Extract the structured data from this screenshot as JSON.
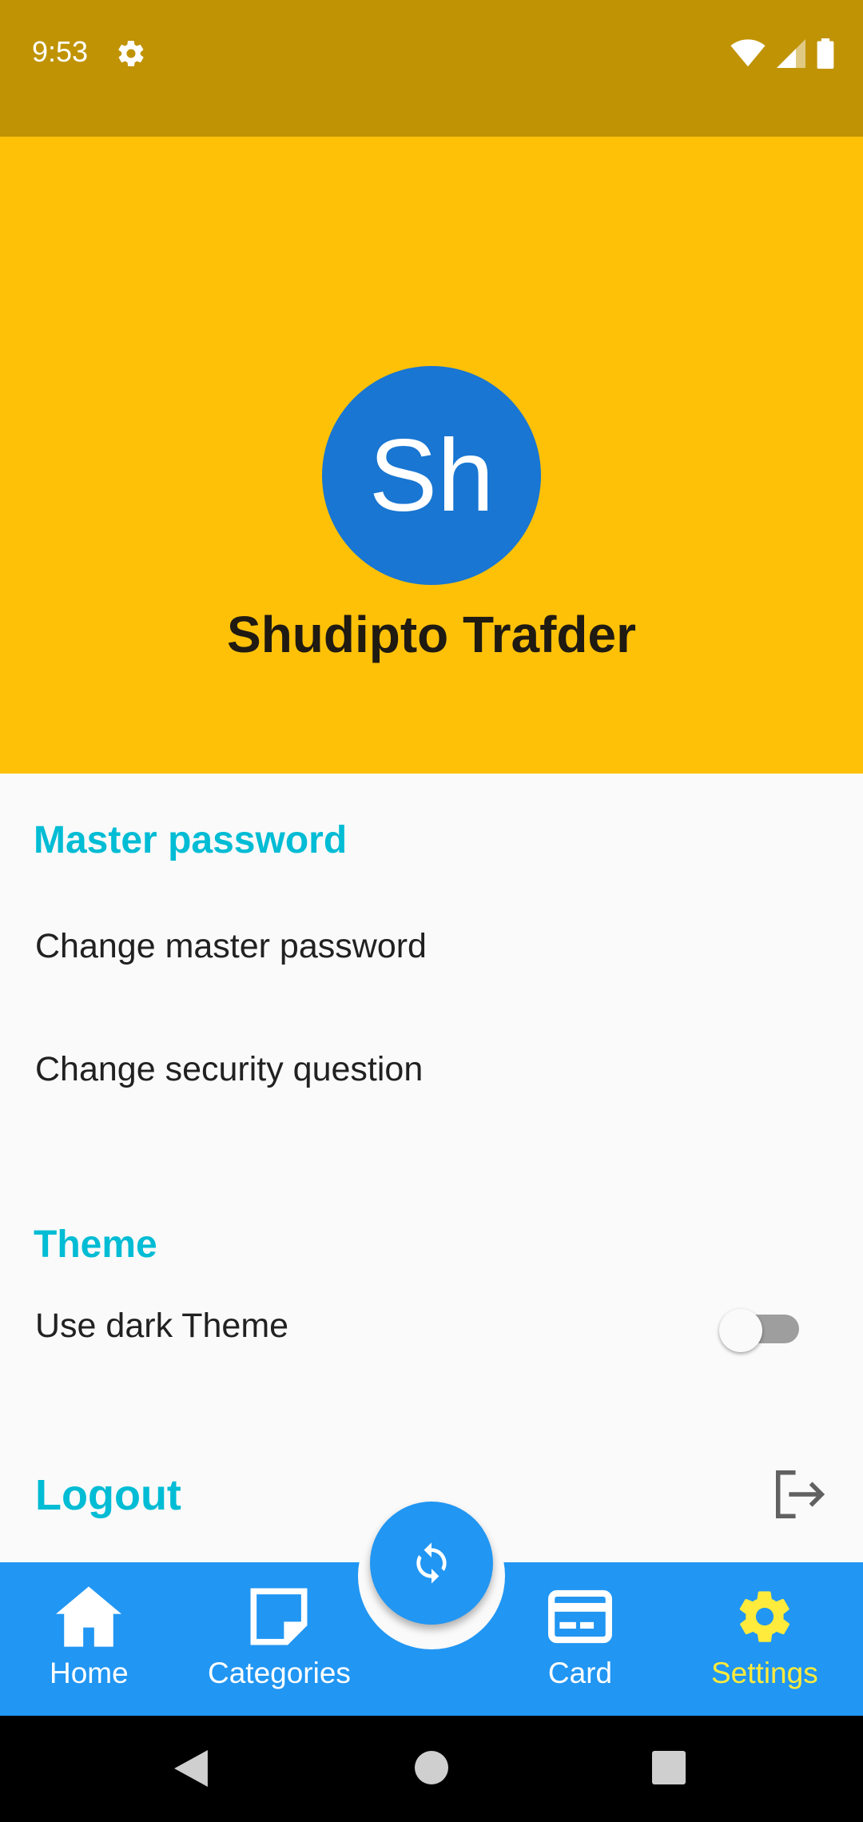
{
  "status_bar": {
    "time": "9:53"
  },
  "profile": {
    "initials": "Sh",
    "name": "Shudipto Trafder"
  },
  "sections": {
    "master_password": {
      "title": "Master password",
      "change_password": "Change master password",
      "change_question": "Change security question"
    },
    "theme": {
      "title": "Theme",
      "dark_theme": "Use dark Theme",
      "dark_theme_enabled": false
    },
    "logout": {
      "label": "Logout"
    }
  },
  "bottom_nav": {
    "items": [
      {
        "label": "Home",
        "icon": "home-icon"
      },
      {
        "label": "Categories",
        "icon": "note-icon"
      },
      {
        "label": "Card",
        "icon": "credit-card-icon"
      },
      {
        "label": "Settings",
        "icon": "gear-icon"
      }
    ],
    "active": "Settings",
    "fab_icon": "sync-icon"
  },
  "colors": {
    "status_bar": "#c09304",
    "header": "#ffc107",
    "avatar": "#1976d2",
    "accent": "#00bcd4",
    "nav_bar": "#2196f3",
    "nav_active": "#ffeb3b"
  }
}
